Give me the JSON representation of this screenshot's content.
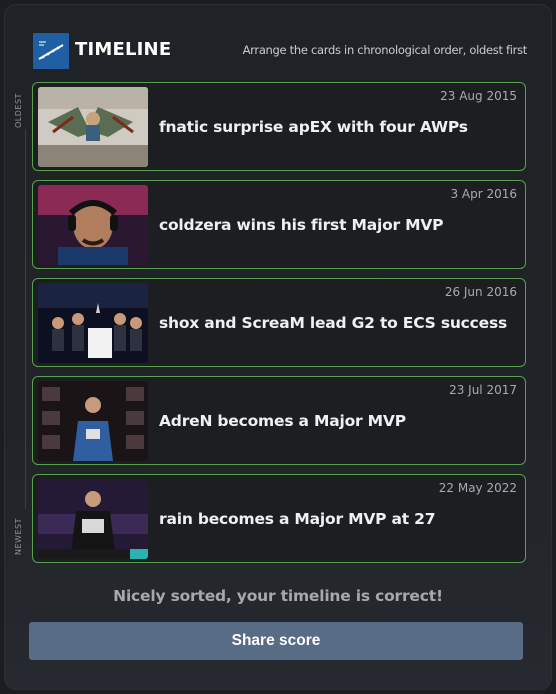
{
  "header": {
    "logo_text": "TIMELINE",
    "logo_icon": "timeline-logo-icon",
    "instruction": "Arrange the cards in chronological order, oldest first"
  },
  "axis": {
    "top_label": "OLDEST",
    "bottom_label": "NEWEST"
  },
  "cards": [
    {
      "date": "23 Aug 2015",
      "title": "fnatic surprise apEX with four AWPs",
      "image": "graffiti-mural-photo"
    },
    {
      "date": "3 Apr 2016",
      "title": "coldzera wins his first Major MVP",
      "image": "player-headset-photo"
    },
    {
      "date": "26 Jun 2016",
      "title": "shox and ScreaM lead G2 to ECS success",
      "image": "team-stage-trophy-photo"
    },
    {
      "date": "23 Jul 2017",
      "title": "AdreN becomes a Major MVP",
      "image": "player-mvp-trophy-photo"
    },
    {
      "date": "22 May 2022",
      "title": "rain becomes a Major MVP at 27",
      "image": "player-mvp-trophy-photo"
    }
  ],
  "result_text": "Nicely sorted, your timeline is correct!",
  "share_label": "Share score",
  "colors": {
    "card_border": "#58a14e",
    "button": "#586c86",
    "logo_bg": "#1f5fa3"
  }
}
